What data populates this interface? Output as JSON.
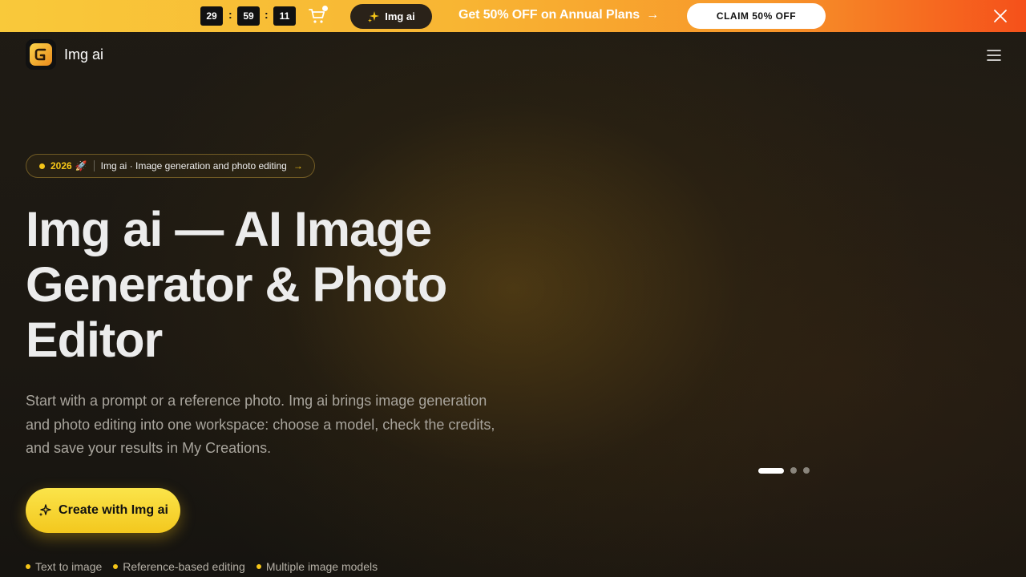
{
  "promo_bar": {
    "timer": {
      "hours": "29",
      "minutes": "59",
      "seconds": "11",
      "separator": ":"
    },
    "icons": {
      "cart": "cart-icon",
      "sparkle": "sparkle-icon",
      "arrow": "arrow-right-icon",
      "close": "close-icon"
    },
    "pill_label": "Img ai",
    "offer_text": "Get 50% OFF on Annual Plans",
    "offer_arrow": "→",
    "claim_label": "CLAIM 50% OFF",
    "colors": {
      "gradient_start": "#f9c93a",
      "gradient_end": "#f5501a"
    }
  },
  "header": {
    "brand_name": "Img ai",
    "icons": {
      "logo": "img-ai-logo",
      "menu": "hamburger-menu-icon"
    }
  },
  "announcement": {
    "year": "2026",
    "emoji": "🚀",
    "text": "Img ai · Image generation and photo editing",
    "arrow": "→"
  },
  "hero": {
    "title": "Img ai — AI Image Generator & Photo Editor",
    "description": "Start with a prompt or a reference photo. Img ai brings image generation and photo editing into one workspace: choose a model, check the credits, and save your results in My Creations.",
    "cta_label": "Create with Img ai",
    "cta_icon": "sparkle-icon",
    "accent_color": "#f5c518"
  },
  "features": [
    {
      "label": "Text to image"
    },
    {
      "label": "Reference-based editing"
    },
    {
      "label": "Multiple image models"
    }
  ],
  "carousel": {
    "total": 3,
    "active_index": 0
  }
}
